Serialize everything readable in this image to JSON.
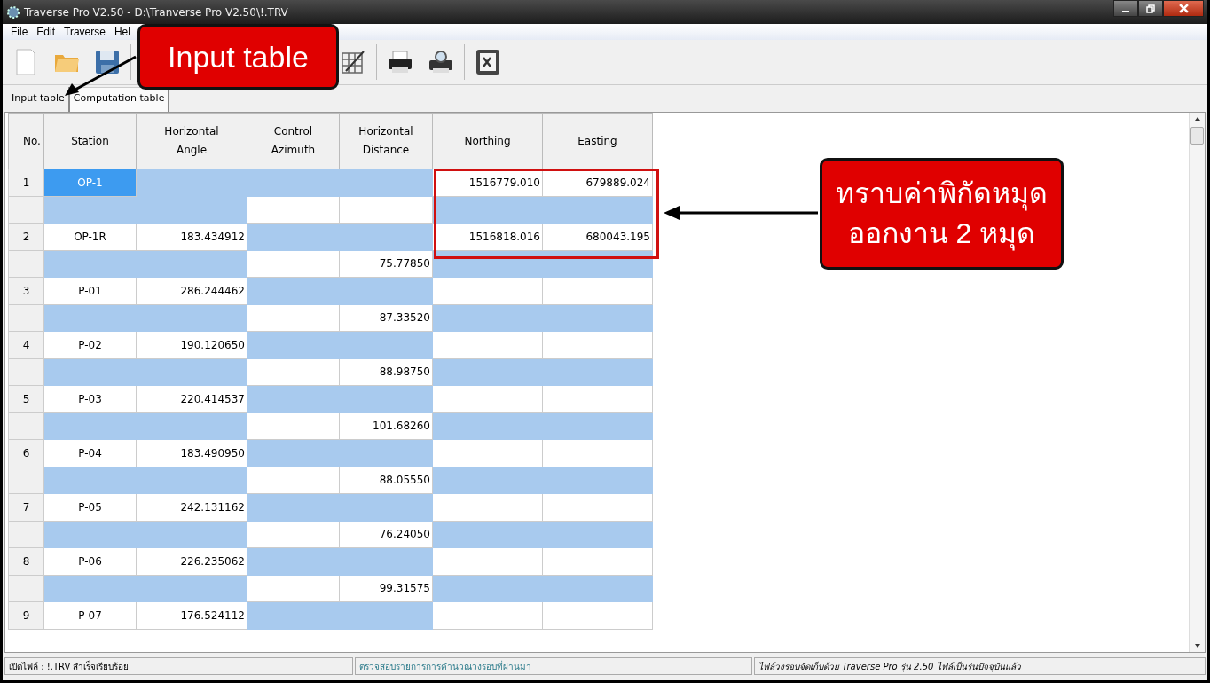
{
  "window": {
    "title": "Traverse Pro V2.50 - D:\\Tranverse Pro V2.50\\!.TRV"
  },
  "menu": [
    "File",
    "Edit",
    "Traverse",
    "Hel"
  ],
  "tabs": [
    {
      "label": "Input table",
      "selected": true
    },
    {
      "label": "Computation table",
      "selected": false
    }
  ],
  "table": {
    "columns": [
      "No.",
      "Station",
      "Horizontal Angle",
      "Control Azimuth",
      "Horizontal Distance",
      "Northing",
      "Easting"
    ],
    "rows": [
      {
        "kind": "station",
        "no": "1",
        "station": "OP-1",
        "northing": "1516779.010",
        "easting": "679889.024",
        "selected": true
      },
      {
        "kind": "leg",
        "selected": false
      },
      {
        "kind": "station",
        "no": "2",
        "station": "OP-1R",
        "angle": "183.434912",
        "northing": "1516818.016",
        "easting": "680043.195",
        "selected": false
      },
      {
        "kind": "leg",
        "distance": "75.77850",
        "selected": false
      },
      {
        "kind": "station",
        "no": "3",
        "station": "P-01",
        "angle": "286.244462",
        "selected": false
      },
      {
        "kind": "leg",
        "distance": "87.33520",
        "selected": false
      },
      {
        "kind": "station",
        "no": "4",
        "station": "P-02",
        "angle": "190.120650",
        "selected": false
      },
      {
        "kind": "leg",
        "distance": "88.98750",
        "selected": false
      },
      {
        "kind": "station",
        "no": "5",
        "station": "P-03",
        "angle": "220.414537",
        "selected": false
      },
      {
        "kind": "leg",
        "distance": "101.68260",
        "selected": false
      },
      {
        "kind": "station",
        "no": "6",
        "station": "P-04",
        "angle": "183.490950",
        "selected": false
      },
      {
        "kind": "leg",
        "distance": "88.05550",
        "selected": false
      },
      {
        "kind": "station",
        "no": "7",
        "station": "P-05",
        "angle": "242.131162",
        "selected": false
      },
      {
        "kind": "leg",
        "distance": "76.24050",
        "selected": false
      },
      {
        "kind": "station",
        "no": "8",
        "station": "P-06",
        "angle": "226.235062",
        "selected": false
      },
      {
        "kind": "leg",
        "distance": "99.31575",
        "selected": false
      },
      {
        "kind": "station",
        "no": "9",
        "station": "P-07",
        "angle": "176.524112",
        "selected": false
      }
    ]
  },
  "status_bar": [
    "เปิดไฟล์ : !.TRV สำเร็จเรียบร้อย",
    "ตรวจสอบรายการการคำนวณวงรอบที่ผ่านมา",
    "ไฟล์วงรอบจัดเก็บด้วย Traverse Pro รุ่น 2.50 ไฟล์เป็นรุ่นปัจจุบันแล้ว"
  ],
  "annotations": [
    {
      "kind": "tab-callout",
      "text": "Input table"
    },
    {
      "kind": "coord-callout",
      "text": "ทราบค่าพิกัดหมุด ออกงาน 2 หมุด"
    }
  ]
}
